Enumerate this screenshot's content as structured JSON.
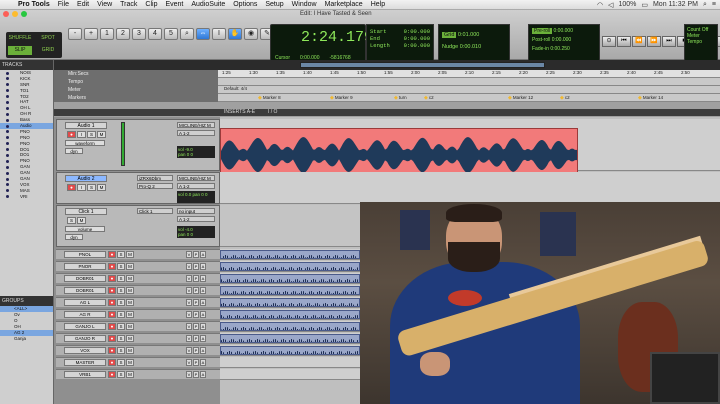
{
  "menubar": {
    "app": "Pro Tools",
    "items": [
      "File",
      "Edit",
      "View",
      "Track",
      "Clip",
      "Event",
      "AudioSuite",
      "Options",
      "Setup",
      "Window",
      "Marketplace",
      "Help"
    ],
    "battery": "100%",
    "clock": "Mon 11:32 PM"
  },
  "window": {
    "title": "Edit: I Have Tasted & Seen"
  },
  "modes": {
    "shuffle": "SHUFFLE",
    "spot": "SPOT",
    "slip": "SLIP",
    "grid": "GRID"
  },
  "counter": {
    "main": "2:24.179",
    "start_label": "Start",
    "start": "0:00.000",
    "end_label": "End",
    "end": "0:00.000",
    "length_label": "Length",
    "length": "0:00.000",
    "cursor_label": "Cursor",
    "cursor": "0:00.000",
    "sample": "-5816768"
  },
  "grid_nudge": {
    "grid_label": "Grid",
    "grid": "0:01.000",
    "nudge_label": "Nudge",
    "nudge": "0:00.010"
  },
  "prepost": {
    "preroll_label": "Pre-roll",
    "preroll": "0:00.000",
    "postroll_label": "Post-roll",
    "postroll": "0:00.000",
    "fadein_label": "Fade-in",
    "fadein": "0:00.250"
  },
  "countoff": {
    "line1": "Count Off",
    "line2": "Meter",
    "line3": "Tempo"
  },
  "tracklist": {
    "header": "TRACKS",
    "items": [
      "NOIS",
      "KICK",
      "SNR",
      "TO1",
      "TO2",
      "HAT",
      "OH L",
      "OH R",
      "Bass",
      "Audio",
      "PNO",
      "PNO",
      "PNO",
      "DO1",
      "DO1",
      "PNO",
      "GAN",
      "GAN",
      "GAN",
      "VOX",
      "MAS",
      "VRI"
    ]
  },
  "groups": {
    "header": "GROUPS",
    "items": [
      "<ALL>",
      "Ov",
      "O",
      "OH",
      "AG 2",
      "Ganja"
    ]
  },
  "rulers": {
    "mins_label": "Min:Secs",
    "tempo_label": "Tempo",
    "meter_label": "Meter",
    "markers_label": "Markers",
    "ticks": [
      "1:25",
      "1:30",
      "1:35",
      "1:40",
      "1:45",
      "1:50",
      "1:55",
      "2:00",
      "2:05",
      "2:10",
      "2:15",
      "2:20",
      "2:25",
      "2:30",
      "2:35",
      "2:40",
      "2:45",
      "2:50"
    ],
    "markers": [
      "Marker 8",
      "Marker 9",
      "turn",
      "c2",
      "Marker 12",
      "c2",
      "Marker 14"
    ],
    "meter_default": "Default: 4/4"
  },
  "tracks": [
    {
      "name": "Audio 1",
      "insert": "",
      "io": "MICLINE/HIZ M",
      "out": "A 1-2",
      "view": "waveform",
      "mode": "dyn",
      "vol": "-9.0",
      "pan": "0 0"
    },
    {
      "name": "Audio 2",
      "insert": "iZRX6Dbm",
      "io": "MICLINE/HIZ M",
      "out": "A 1-2",
      "insert2": "Pro-Q 2",
      "view": "waveform",
      "mode": "dyn",
      "vol": "0.0",
      "pan": "0 0"
    },
    {
      "name": "Click 1",
      "insert": "Click 1",
      "io": "no input",
      "out": "A 1-2",
      "view": "volume",
      "mode": "dyn",
      "vol": "-4.0",
      "pan": "0 0"
    }
  ],
  "small_tracks": [
    "PNOL",
    "PNOR",
    "DOBR01",
    "DOBR01",
    "AG L",
    "AG R",
    "GANJO L",
    "GANJO R",
    "VOX",
    "MASTER",
    "VRB1"
  ],
  "inserts_header": "INSERTS A-E",
  "io_header": "I / O",
  "colors": {
    "clip_red": "#f27a7a",
    "clip_blue": "#9aa7c9",
    "counter_green": "#8ee85a",
    "selected": "#8cb8ff"
  }
}
